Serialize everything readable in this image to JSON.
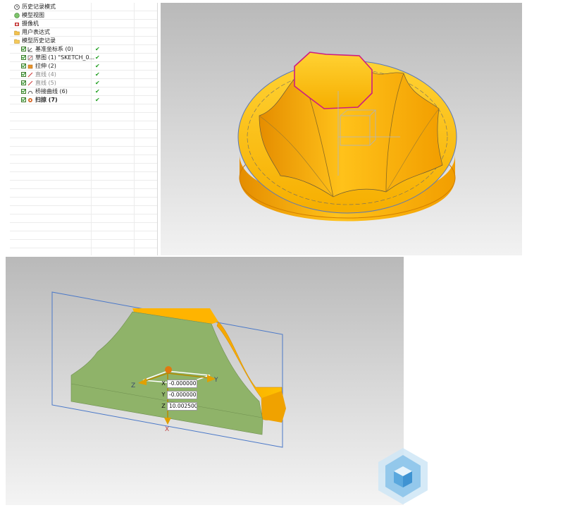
{
  "model_tree": {
    "items": [
      {
        "label": "历史记录模式",
        "icon": "clock-icon",
        "checkbox": false,
        "check": false
      },
      {
        "label": "模型视图",
        "icon": "model-view-icon",
        "checkbox": false,
        "check": false
      },
      {
        "label": "摄像机",
        "icon": "camera-icon",
        "checkbox": false,
        "check": false
      },
      {
        "label": "用户表达式",
        "icon": "folder-icon",
        "checkbox": false,
        "check": false
      },
      {
        "label": "模型历史记录",
        "icon": "folder-open-icon",
        "checkbox": false,
        "check": false
      },
      {
        "label": "基准坐标系 (0)",
        "icon": "datum-csys-icon",
        "checkbox": true,
        "check": true
      },
      {
        "label": "草图 (1) \"SKETCH_0...",
        "icon": "sketch-icon",
        "checkbox": true,
        "check": true
      },
      {
        "label": "拉伸 (2)",
        "icon": "extrude-icon",
        "checkbox": true,
        "check": true
      },
      {
        "label": "直线 (4)",
        "icon": "line-icon",
        "checkbox": true,
        "check": true,
        "dimmed": true
      },
      {
        "label": "直线 (5)",
        "icon": "line-icon",
        "checkbox": true,
        "check": true,
        "dimmed": true
      },
      {
        "label": "桥接曲线 (6)",
        "icon": "bridge-curve-icon",
        "checkbox": true,
        "check": true
      },
      {
        "label": "扫掠 (7)",
        "icon": "sweep-icon",
        "checkbox": true,
        "check": true,
        "bold": true
      }
    ],
    "check_glyph": "✔"
  },
  "coordinate_dialog": {
    "x_label": "X",
    "x_value": "-0.000000",
    "y_label": "Y",
    "y_value": "-0.000000",
    "z_label": "Z",
    "z_value": "10.002500"
  },
  "axis_labels": {
    "z": "Z",
    "y": "Y",
    "x": "X"
  },
  "colors": {
    "part_orange": "#f7b400",
    "part_dark_orange": "#e08a00",
    "section_green": "#8fb369",
    "plane_blue": "#4a78c8",
    "edge_magenta": "#cc1d82",
    "check_green": "#22a022"
  }
}
